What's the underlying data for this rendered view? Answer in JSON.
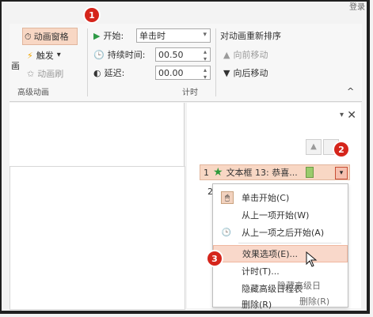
{
  "window": {
    "top_right_text": "登录"
  },
  "ribbon": {
    "advanced_animation": {
      "label_partial": "画",
      "animation_pane_label": "动画窗格",
      "trigger_label": "触发",
      "animation_painter_label": "动画刷",
      "group_label": "高级动画"
    },
    "timing": {
      "start_label": "开始:",
      "start_value": "单击时",
      "duration_label": "持续时间:",
      "duration_value": "00.50",
      "delay_label": "延迟:",
      "delay_value": "00.00",
      "group_label": "计时"
    },
    "reorder": {
      "title": "对动画重新排序",
      "move_earlier": "向前移动",
      "move_later": "向后移动"
    }
  },
  "animation_pane": {
    "row1": {
      "index": "1",
      "label": "文本框 13: 恭喜..."
    },
    "row2": {
      "index": "2"
    }
  },
  "context_menu": {
    "items": [
      "单击开始(C)",
      "从上一项开始(W)",
      "从上一项之后开始(A)",
      "效果选项(E)...",
      "计时(T)...",
      "隐藏高级日程表",
      "删除(R)"
    ],
    "ghost_texts": [
      "隐藏高级日",
      "删除(R)"
    ]
  },
  "badges": [
    "1",
    "2",
    "3"
  ],
  "colors": {
    "highlight": "#f8d7c4",
    "badge": "#d5251b",
    "star": "#2f9a3b"
  }
}
